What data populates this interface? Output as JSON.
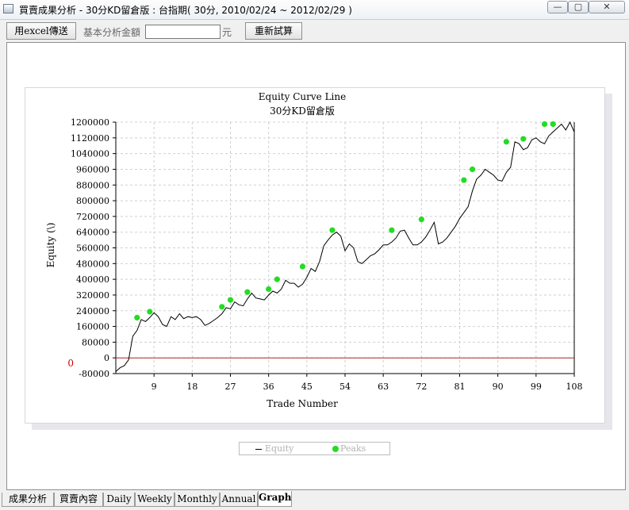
{
  "window": {
    "title": "買賣成果分析 - 30分KD留倉版 : 台指期( 30分, 2010/02/24 ~ 2012/02/29 )",
    "minimize_glyph": "—",
    "maximize_glyph": "▢",
    "close_glyph": "✕"
  },
  "toolbar": {
    "excel_label": "用excel傳送",
    "amount_label": "基本分析金額",
    "amount_value": "",
    "unit_label": "元",
    "recalc_label": "重新試算"
  },
  "tabs": [
    "成果分析",
    "買賣內容",
    "Daily",
    "Weekly",
    "Monthly",
    "Annual",
    "Graph"
  ],
  "active_tab": "Graph",
  "legend": {
    "equity": "Equity",
    "peaks": "Peaks"
  },
  "colors": {
    "equity_line": "#000000",
    "peak_marker": "#22dd22",
    "zero_line": "#b22222",
    "zero_label": "#cc0000"
  },
  "chart_data": {
    "type": "line",
    "title": "Equity Curve Line",
    "subtitle": "30分KD留倉版",
    "xlabel": "Trade Number",
    "ylabel": "Equity (\\)",
    "xlim": [
      0,
      108
    ],
    "ylim": [
      -80000,
      1200000
    ],
    "xticks": [
      9,
      18,
      27,
      36,
      45,
      54,
      63,
      72,
      81,
      90,
      99,
      108
    ],
    "yticks": [
      -80000,
      0,
      80000,
      160000,
      240000,
      320000,
      400000,
      480000,
      560000,
      640000,
      720000,
      800000,
      880000,
      960000,
      1040000,
      1120000,
      1200000
    ],
    "zero_label": "0",
    "grid": true,
    "legend_position": "bottom",
    "series": [
      {
        "name": "Equity",
        "x": [
          0,
          1,
          2,
          3,
          4,
          5,
          6,
          7,
          8,
          9,
          10,
          11,
          12,
          13,
          14,
          15,
          16,
          17,
          18,
          19,
          20,
          21,
          22,
          23,
          24,
          25,
          26,
          27,
          28,
          29,
          30,
          31,
          32,
          33,
          34,
          35,
          36,
          37,
          38,
          39,
          40,
          41,
          42,
          43,
          44,
          45,
          46,
          47,
          48,
          49,
          50,
          51,
          52,
          53,
          54,
          55,
          56,
          57,
          58,
          59,
          60,
          61,
          62,
          63,
          64,
          65,
          66,
          67,
          68,
          69,
          70,
          71,
          72,
          73,
          74,
          75,
          76,
          77,
          78,
          79,
          80,
          81,
          82,
          83,
          84,
          85,
          86,
          87,
          88,
          89,
          90,
          91,
          92,
          93,
          94,
          95,
          96,
          97,
          98,
          99,
          100,
          101,
          102,
          103,
          104,
          105,
          106,
          107,
          108
        ],
        "y": [
          -70000,
          -50000,
          -40000,
          -10000,
          110000,
          140000,
          195000,
          185000,
          205000,
          230000,
          210000,
          170000,
          160000,
          210000,
          195000,
          225000,
          200000,
          210000,
          205000,
          210000,
          195000,
          165000,
          175000,
          190000,
          205000,
          225000,
          255000,
          250000,
          285000,
          270000,
          265000,
          300000,
          330000,
          305000,
          300000,
          295000,
          320000,
          340000,
          330000,
          350000,
          395000,
          380000,
          380000,
          360000,
          375000,
          410000,
          455000,
          440000,
          490000,
          570000,
          600000,
          625000,
          640000,
          620000,
          545000,
          580000,
          560000,
          490000,
          480000,
          500000,
          520000,
          530000,
          550000,
          575000,
          575000,
          590000,
          610000,
          645000,
          650000,
          610000,
          575000,
          575000,
          590000,
          615000,
          650000,
          690000,
          580000,
          590000,
          610000,
          640000,
          670000,
          710000,
          740000,
          770000,
          850000,
          910000,
          930000,
          960000,
          945000,
          930000,
          905000,
          900000,
          945000,
          970000,
          1100000,
          1090000,
          1060000,
          1070000,
          1110000,
          1120000,
          1100000,
          1090000,
          1130000,
          1150000,
          1170000,
          1190000,
          1160000,
          1200000,
          1150000
        ],
        "peaks_x": [
          5,
          8,
          25,
          27,
          31,
          36,
          38,
          44,
          51,
          65,
          72,
          82,
          84,
          92,
          96,
          101,
          103
        ],
        "peaks_y": [
          205000,
          235000,
          260000,
          295000,
          335000,
          350000,
          400000,
          465000,
          650000,
          650000,
          705000,
          905000,
          960000,
          1100000,
          1115000,
          1190000,
          1190000
        ]
      }
    ]
  }
}
